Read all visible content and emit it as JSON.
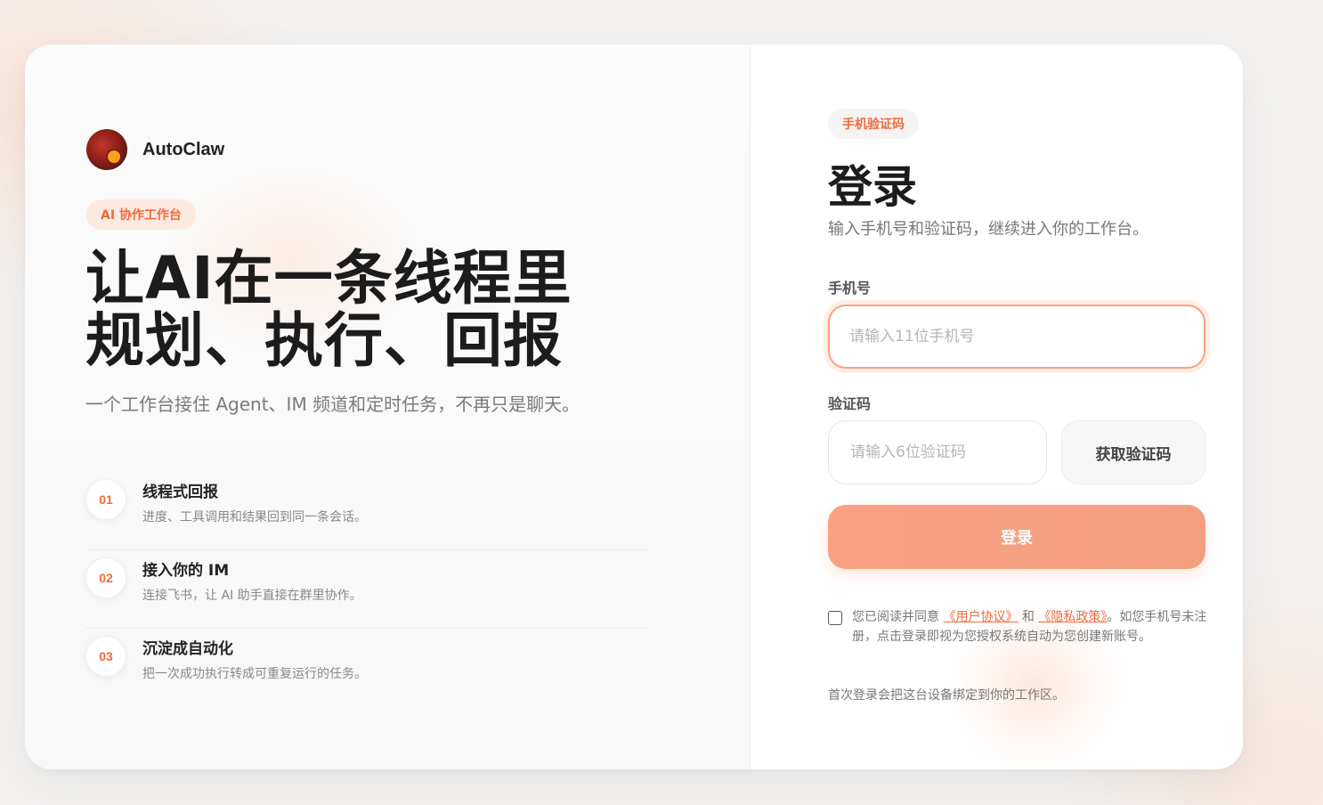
{
  "brand": {
    "name": "AutoClaw"
  },
  "left": {
    "pill": "AI 协作工作台",
    "headline_line1": "让AI在一条线程里",
    "headline_line2": "规划、执行、回报",
    "subtitle": "一个工作台接住 Agent、IM 频道和定时任务，不再只是聊天。",
    "features": [
      {
        "num": "01",
        "title": "线程式回报",
        "desc": "进度、工具调用和结果回到同一条会话。"
      },
      {
        "num": "02",
        "title": "接入你的 IM",
        "desc": "连接飞书，让 AI 助手直接在群里协作。"
      },
      {
        "num": "03",
        "title": "沉淀成自动化",
        "desc": "把一次成功执行转成可重复运行的任务。"
      }
    ]
  },
  "login": {
    "pill": "手机验证码",
    "title": "登录",
    "subtitle": "输入手机号和验证码，继续进入你的工作台。",
    "phone_label": "手机号",
    "phone_placeholder": "请输入11位手机号",
    "phone_value": "",
    "code_label": "验证码",
    "code_placeholder": "请输入6位验证码",
    "code_value": "",
    "get_code": "获取验证码",
    "submit": "登录",
    "agree_prefix": "您已阅读并同意",
    "user_agreement": "《用户协议》",
    "agree_and": "和",
    "privacy_policy": "《隐私政策》",
    "agree_suffix": "。如您手机号未注册，点击登录即视为您授权系统自动为您创建新账号。",
    "agreed": false,
    "bind_note": "首次登录会把这台设备绑定到你的工作区。"
  },
  "colors": {
    "accent": "#f06a3c",
    "button": "#f9a283",
    "focus_border": "#f8a27e"
  }
}
